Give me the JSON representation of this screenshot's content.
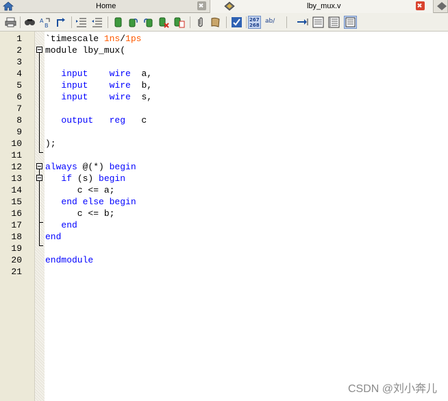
{
  "tabs": [
    {
      "label": "Home",
      "icon": "home-icon",
      "active": false
    },
    {
      "label": "lby_mux.v",
      "icon": "verilog-file-icon",
      "active": true
    }
  ],
  "toolbar": {
    "icons": [
      "print-icon",
      "find-icon",
      "replace-icon",
      "goto-icon",
      "indent-icon",
      "outdent-icon",
      "bookmark-icon",
      "bookmark-next-icon",
      "bookmark-prev-icon",
      "bookmark-clear-icon",
      "bookmark-list-icon",
      "attach-icon",
      "paste-icon",
      "spellcheck-icon",
      "line-numbers-icon",
      "wrap-icon",
      "tab-icon",
      "split-horizontal-icon",
      "split-vertical-icon",
      "column-mode-icon"
    ],
    "line_numbers_label": "267 268",
    "wrap_label": "ab/"
  },
  "editor": {
    "line_numbers": [
      "1",
      "2",
      "3",
      "4",
      "5",
      "6",
      "7",
      "8",
      "9",
      "10",
      "11",
      "12",
      "13",
      "14",
      "15",
      "16",
      "17",
      "18",
      "19",
      "20",
      "21"
    ],
    "lines": [
      [
        {
          "t": "`timescale ",
          "c": ""
        },
        {
          "t": "1ns",
          "c": "num"
        },
        {
          "t": "/",
          "c": ""
        },
        {
          "t": "1ps",
          "c": "num"
        }
      ],
      [
        {
          "t": "module lby_mux(",
          "c": ""
        }
      ],
      [],
      [
        {
          "t": "   ",
          "c": ""
        },
        {
          "t": "input",
          "c": "kw"
        },
        {
          "t": "    ",
          "c": ""
        },
        {
          "t": "wire",
          "c": "kw"
        },
        {
          "t": "  a,",
          "c": ""
        }
      ],
      [
        {
          "t": "   ",
          "c": ""
        },
        {
          "t": "input",
          "c": "kw"
        },
        {
          "t": "    ",
          "c": ""
        },
        {
          "t": "wire",
          "c": "kw"
        },
        {
          "t": "  b,",
          "c": ""
        }
      ],
      [
        {
          "t": "   ",
          "c": ""
        },
        {
          "t": "input",
          "c": "kw"
        },
        {
          "t": "    ",
          "c": ""
        },
        {
          "t": "wire",
          "c": "kw"
        },
        {
          "t": "  s,",
          "c": ""
        }
      ],
      [],
      [
        {
          "t": "   ",
          "c": ""
        },
        {
          "t": "output",
          "c": "kw"
        },
        {
          "t": "   ",
          "c": ""
        },
        {
          "t": "reg",
          "c": "kw"
        },
        {
          "t": "   c",
          "c": ""
        }
      ],
      [],
      [
        {
          "t": ");",
          "c": ""
        }
      ],
      [],
      [
        {
          "t": "always",
          "c": "kw"
        },
        {
          "t": " @(*) ",
          "c": ""
        },
        {
          "t": "begin",
          "c": "kw"
        }
      ],
      [
        {
          "t": "   ",
          "c": ""
        },
        {
          "t": "if",
          "c": "kw"
        },
        {
          "t": " (s) ",
          "c": ""
        },
        {
          "t": "begin",
          "c": "kw"
        }
      ],
      [
        {
          "t": "      c <= a;",
          "c": ""
        }
      ],
      [
        {
          "t": "   ",
          "c": ""
        },
        {
          "t": "end else begin",
          "c": "kw"
        }
      ],
      [
        {
          "t": "      c <= b;",
          "c": ""
        }
      ],
      [
        {
          "t": "   ",
          "c": ""
        },
        {
          "t": "end",
          "c": "kw"
        }
      ],
      [
        {
          "t": "end",
          "c": "kw"
        }
      ],
      [],
      [
        {
          "t": "endmodule",
          "c": "kw"
        }
      ],
      []
    ]
  },
  "watermark": "CSDN @刘小奔儿",
  "colors": {
    "keyword": "#0000ff",
    "number": "#ff5a00",
    "gutter": "#ece9d8"
  }
}
